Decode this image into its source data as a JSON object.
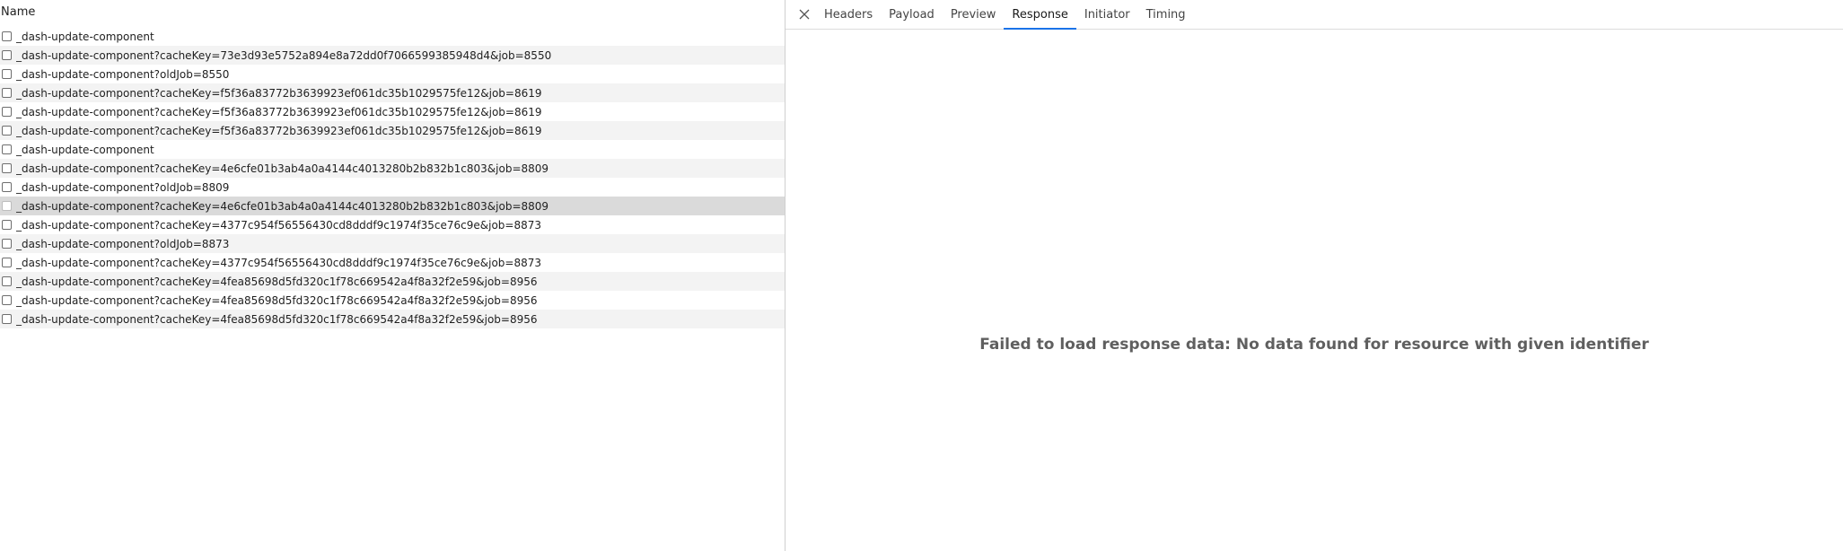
{
  "list": {
    "header": "Name",
    "rows": [
      "_dash-update-component",
      "_dash-update-component?cacheKey=73e3d93e5752a894e8a72dd0f7066599385948d4&job=8550",
      "_dash-update-component?oldJob=8550",
      "_dash-update-component?cacheKey=f5f36a83772b3639923ef061dc35b1029575fe12&job=8619",
      "_dash-update-component?cacheKey=f5f36a83772b3639923ef061dc35b1029575fe12&job=8619",
      "_dash-update-component?cacheKey=f5f36a83772b3639923ef061dc35b1029575fe12&job=8619",
      "_dash-update-component",
      "_dash-update-component?cacheKey=4e6cfe01b3ab4a0a4144c4013280b2b832b1c803&job=8809",
      "_dash-update-component?oldJob=8809",
      "_dash-update-component?cacheKey=4e6cfe01b3ab4a0a4144c4013280b2b832b1c803&job=8809",
      "_dash-update-component?cacheKey=4377c954f56556430cd8dddf9c1974f35ce76c9e&job=8873",
      "_dash-update-component?oldJob=8873",
      "_dash-update-component?cacheKey=4377c954f56556430cd8dddf9c1974f35ce76c9e&job=8873",
      "_dash-update-component?cacheKey=4fea85698d5fd320c1f78c669542a4f8a32f2e59&job=8956",
      "_dash-update-component?cacheKey=4fea85698d5fd320c1f78c669542a4f8a32f2e59&job=8956",
      "_dash-update-component?cacheKey=4fea85698d5fd320c1f78c669542a4f8a32f2e59&job=8956"
    ],
    "selected_index": 9
  },
  "detail": {
    "close_icon": "close-icon",
    "tabs": [
      "Headers",
      "Payload",
      "Preview",
      "Response",
      "Initiator",
      "Timing"
    ],
    "active_tab": "Response",
    "message": "Failed to load response data: No data found for resource with given identifier"
  },
  "colors": {
    "accent": "#1a73e8",
    "selected_row": "#dadada",
    "alt_row": "#f3f3f3",
    "message_text": "#5f5f5f"
  }
}
